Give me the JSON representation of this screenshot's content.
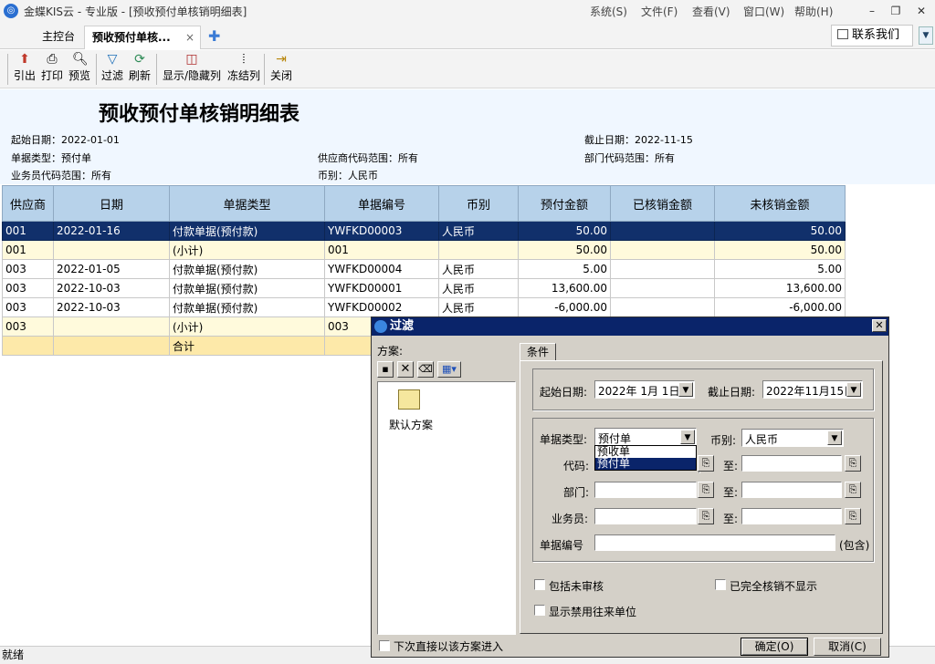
{
  "window": {
    "title": "金蝶KIS云 - 专业版 - [预收预付单核销明细表]",
    "menus": [
      "系统(S)",
      "文件(F)",
      "查看(V)",
      "窗口(W)",
      "帮助(H)"
    ]
  },
  "tabs": {
    "home": "主控台",
    "active": "预收预付单核...",
    "close": "×",
    "add": "✚"
  },
  "contact": {
    "label": "联系我们"
  },
  "toolbar": {
    "export": "引出",
    "print": "打印",
    "preview": "预览",
    "filter": "过滤",
    "refresh": "刷新",
    "show_hide": "显示/隐藏列",
    "freeze": "冻结列",
    "close": "关闭"
  },
  "report": {
    "title": "预收预付单核销明细表",
    "start_date": "起始日期：2022-01-01",
    "end_date": "截止日期：2022-11-15",
    "doc_type": "单据类型：预付单",
    "supplier_range": "供应商代码范围：所有",
    "dept_range": "部门代码范围：所有",
    "staff_range": "业务员代码范围：所有",
    "currency": "币别：人民币"
  },
  "table": {
    "columns": [
      "供应商",
      "日期",
      "单据类型",
      "单据编号",
      "币别",
      "预付金额",
      "已核销金额",
      "未核销金额"
    ],
    "rows": [
      [
        "001",
        "2022-01-16",
        "付款单据(预付款)",
        "YWFKD00003",
        "人民币",
        "50.00",
        "",
        "50.00"
      ],
      [
        "001",
        "",
        "(小计)",
        "001",
        "",
        "50.00",
        "",
        "50.00"
      ],
      [
        "003",
        "2022-01-05",
        "付款单据(预付款)",
        "YWFKD00004",
        "人民币",
        "5.00",
        "",
        "5.00"
      ],
      [
        "003",
        "2022-10-03",
        "付款单据(预付款)",
        "YWFKD00001",
        "人民币",
        "13,600.00",
        "",
        "13,600.00"
      ],
      [
        "003",
        "2022-10-03",
        "付款单据(预付款)",
        "YWFKD00002",
        "人民币",
        "-6,000.00",
        "",
        "-6,000.00"
      ],
      [
        "003",
        "",
        "(小计)",
        "003",
        "",
        "",
        "",
        ""
      ],
      [
        "",
        "",
        "合计",
        "",
        "",
        "",
        "",
        ""
      ]
    ]
  },
  "status": {
    "text": "就绪"
  },
  "dialog": {
    "title": "过滤",
    "scheme_label": "方案:",
    "default_scheme": "默认方案",
    "tab_conditions": "条件",
    "start_date_label": "起始日期:",
    "start_date_value": "2022年 1月 1日",
    "end_date_label": "截止日期:",
    "end_date_value": "2022年11月15日",
    "doc_type_label": "单据类型:",
    "doc_type_value": "预付单",
    "doc_type_options": [
      "预收单",
      "预付单"
    ],
    "currency_label": "币别:",
    "currency_value": "人民币",
    "code_label": "代码:",
    "dept_label": "部门:",
    "staff_label": "业务员:",
    "to_label": "至:",
    "doc_no_label": "单据编号",
    "contains_label": "(包含)",
    "include_unaudited": "包括未审核",
    "hide_fully_settled": "已完全核销不显示",
    "show_disabled_partners": "显示禁用往来单位",
    "enter_directly": "下次直接以该方案进入",
    "ok": "确定(O)",
    "cancel": "取消(C)"
  }
}
